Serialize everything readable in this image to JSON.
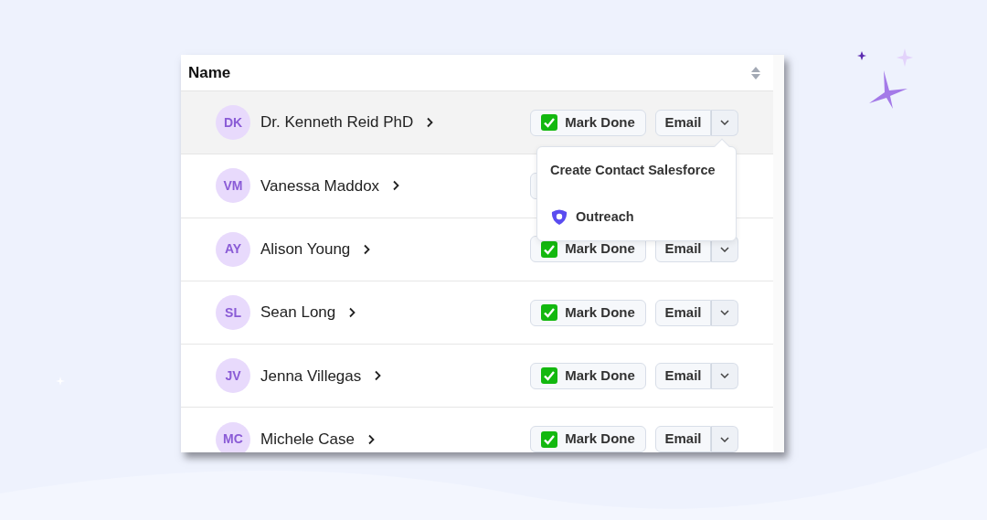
{
  "table": {
    "columns": [
      {
        "label": "Name",
        "sortable": true
      }
    ],
    "rows": [
      {
        "initials": "DK",
        "name": "Dr. Kenneth Reid PhD",
        "selected": true,
        "mark_done": "Mark Done",
        "email": "Email"
      },
      {
        "initials": "VM",
        "name": "Vanessa Maddox",
        "selected": false
      },
      {
        "initials": "AY",
        "name": "Alison Young",
        "selected": false,
        "mark_done": "Mark Done",
        "email": "Email"
      },
      {
        "initials": "SL",
        "name": "Sean Long",
        "selected": false,
        "mark_done": "Mark Done",
        "email": "Email"
      },
      {
        "initials": "JV",
        "name": "Jenna Villegas",
        "selected": false,
        "mark_done": "Mark Done",
        "email": "Email"
      },
      {
        "initials": "MC",
        "name": "Michele Case",
        "selected": false,
        "mark_done": "Mark Done",
        "email": "Email"
      }
    ]
  },
  "dropdown_menu": {
    "items": [
      {
        "label": "Create Contact Salesforce",
        "kind": "text"
      },
      {
        "label": "Outreach",
        "kind": "icon"
      }
    ]
  }
}
